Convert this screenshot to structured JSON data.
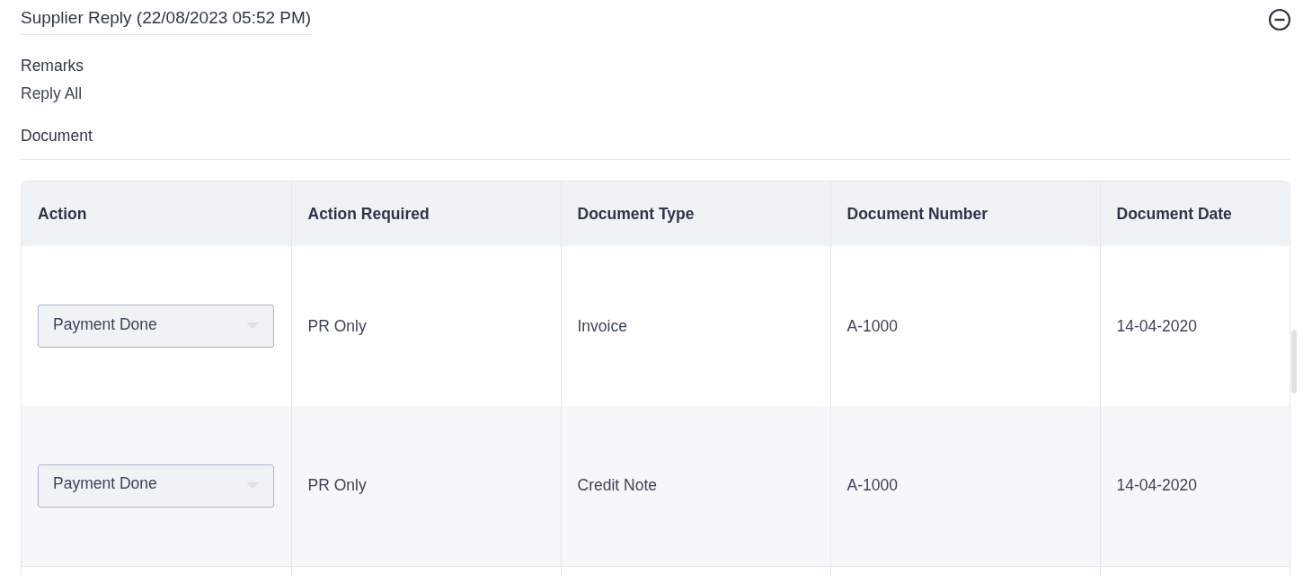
{
  "section": {
    "title": "Supplier Reply (22/08/2023 05:52 PM)",
    "expanded": true
  },
  "remarks": {
    "label": "Remarks",
    "value": "Reply All"
  },
  "document": {
    "heading": "Document"
  },
  "table": {
    "columns": [
      {
        "label": "Action",
        "kind": "dropdown"
      },
      {
        "label": "Action Required",
        "kind": "text"
      },
      {
        "label": "Document Type",
        "kind": "text"
      },
      {
        "label": "Document Number",
        "kind": "text"
      },
      {
        "label": "Document Date",
        "kind": "text"
      }
    ],
    "rows": [
      {
        "cells": [
          "Payment Done",
          "PR Only",
          "Invoice",
          "A-1000",
          "14-04-2020"
        ]
      },
      {
        "cells": [
          "Payment Done",
          "PR Only",
          "Credit Note",
          "A-1000",
          "14-04-2020"
        ]
      }
    ]
  }
}
